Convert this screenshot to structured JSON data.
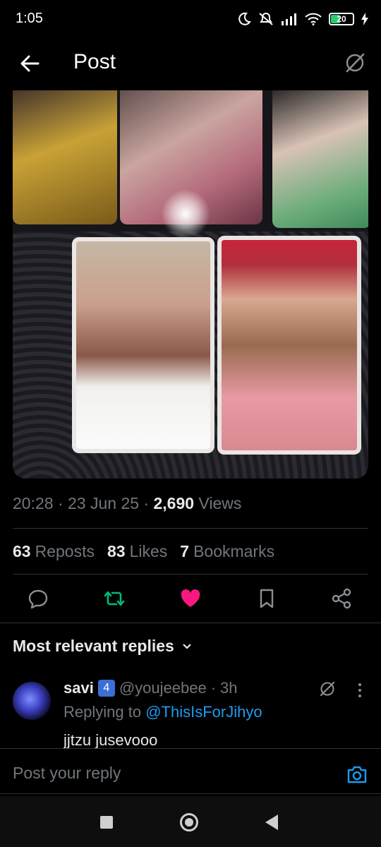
{
  "status_bar": {
    "time": "1:05",
    "battery": "20",
    "icons": [
      "moon-icon",
      "mute-icon",
      "signal-icon",
      "wifi-icon",
      "battery-icon",
      "charging-icon"
    ]
  },
  "header": {
    "title": "Post",
    "back_icon": "arrow-left-icon",
    "right_icon": "grok-icon"
  },
  "post": {
    "time": "20:28",
    "date": "23 Jun 25",
    "views_count": "2,690",
    "views_label": "Views",
    "reposts_count": "63",
    "reposts_label": "Reposts",
    "likes_count": "83",
    "likes_label": "Likes",
    "bookmarks_count": "7",
    "bookmarks_label": "Bookmarks",
    "liked": true,
    "reposted": true
  },
  "actions": [
    "reply-icon",
    "repost-icon",
    "like-icon",
    "bookmark-icon",
    "share-icon"
  ],
  "replies": {
    "heading": "Most relevant replies",
    "items": [
      {
        "name": "savi",
        "badge": "4",
        "handle": "@youjeebee",
        "sep": "·",
        "time": "3h",
        "replying_prefix": "Replying to",
        "replying_to": "@ThisIsForJihyo",
        "text": "jjtzu jusevooo"
      }
    ]
  },
  "reply_bar": {
    "placeholder": "Post your reply"
  },
  "colors": {
    "accent": "#1d9bf0",
    "like": "#f91880",
    "repost": "#00ba7c",
    "muted": "#71767b",
    "text": "#e7e9ea"
  }
}
